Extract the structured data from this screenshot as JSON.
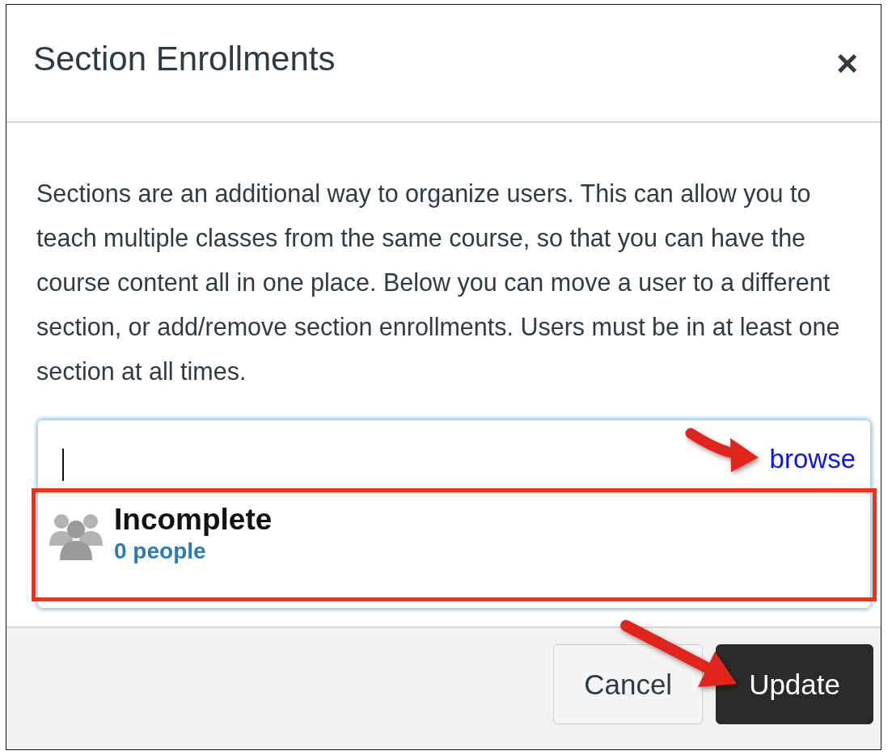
{
  "dialog": {
    "title": "Section Enrollments",
    "close": "×"
  },
  "description": "Sections are an additional way to organize users. This can allow you to teach multiple classes from the same course, so that you can have the course content all in one place. Below you can move a user to a different section, or add/remove section enrollments. Users must be in at least one section at all times.",
  "section_search": {
    "browse_link": "browse",
    "results": [
      {
        "name": "Incomplete",
        "count": "0 people"
      }
    ]
  },
  "buttons": [
    {
      "label": "Cancel",
      "kind": "secondary"
    },
    {
      "label": "Update",
      "kind": "primary"
    }
  ]
}
